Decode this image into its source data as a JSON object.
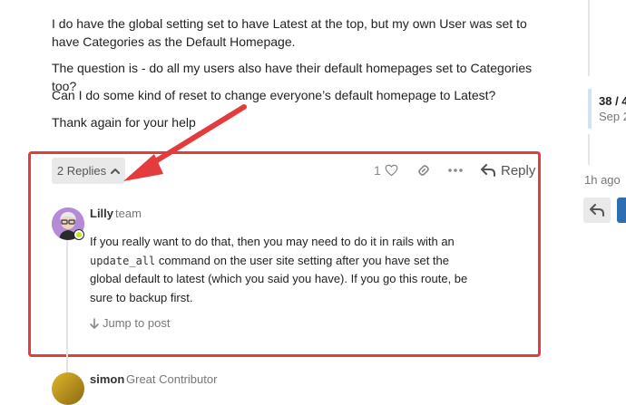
{
  "post": {
    "clipped_line": "(clipped above)",
    "paragraphs": [
      "I do have the global setting set to have Latest at the top, but my own User was set to have Categories as the Default Homepage.",
      "The question is - do all my users also have their default homepages set to Categories too?",
      "Can I do some kind of reset to change everyone’s default homepage to Latest?",
      "Thank again for your help"
    ],
    "like_count": "1",
    "replies_label": "2 Replies",
    "reply_label": "Reply"
  },
  "timeline": {
    "position": "38 / 4",
    "date": "Sep 2",
    "last_activity": "1h ago"
  },
  "embedded_reply": {
    "username": "Lilly",
    "user_title": "team",
    "text_before_code": "If you really want to do that, then you may need to do it in rails with an ",
    "code": "update_all",
    "text_after_code": " command on the user site setting after you have set the global default to latest (which you said you have). If you go this route, be sure to backup first.",
    "jump_label": "Jump to post"
  },
  "next_reply": {
    "username": "simon",
    "user_title": "Great Contributor"
  },
  "colors": {
    "highlight": "#e43c3c",
    "accent": "#2f6fb1"
  },
  "icons": [
    "heart-icon",
    "link-icon",
    "ellipsis-icon",
    "reply-icon",
    "chevron-up-icon",
    "arrow-down-icon",
    "back-icon"
  ]
}
